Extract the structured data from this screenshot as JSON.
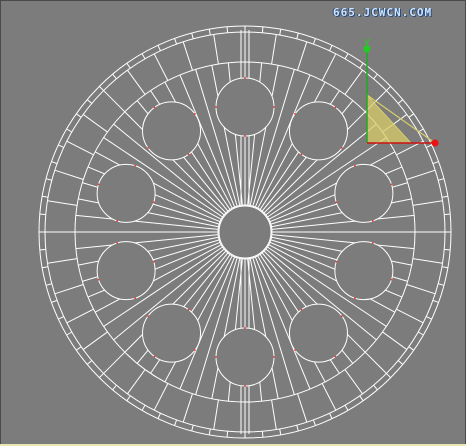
{
  "viewport": {
    "background": "#7c7c7c",
    "wire_color": "#ffffff",
    "vertex_color": "#ff3030"
  },
  "watermark": {
    "text": "665.JCWCN.COM"
  },
  "gizmo": {
    "y_label": "y",
    "x_axis_color": "#cc1111",
    "y_axis_color": "#22aa22",
    "plane_color": "#d8cc6a"
  }
}
